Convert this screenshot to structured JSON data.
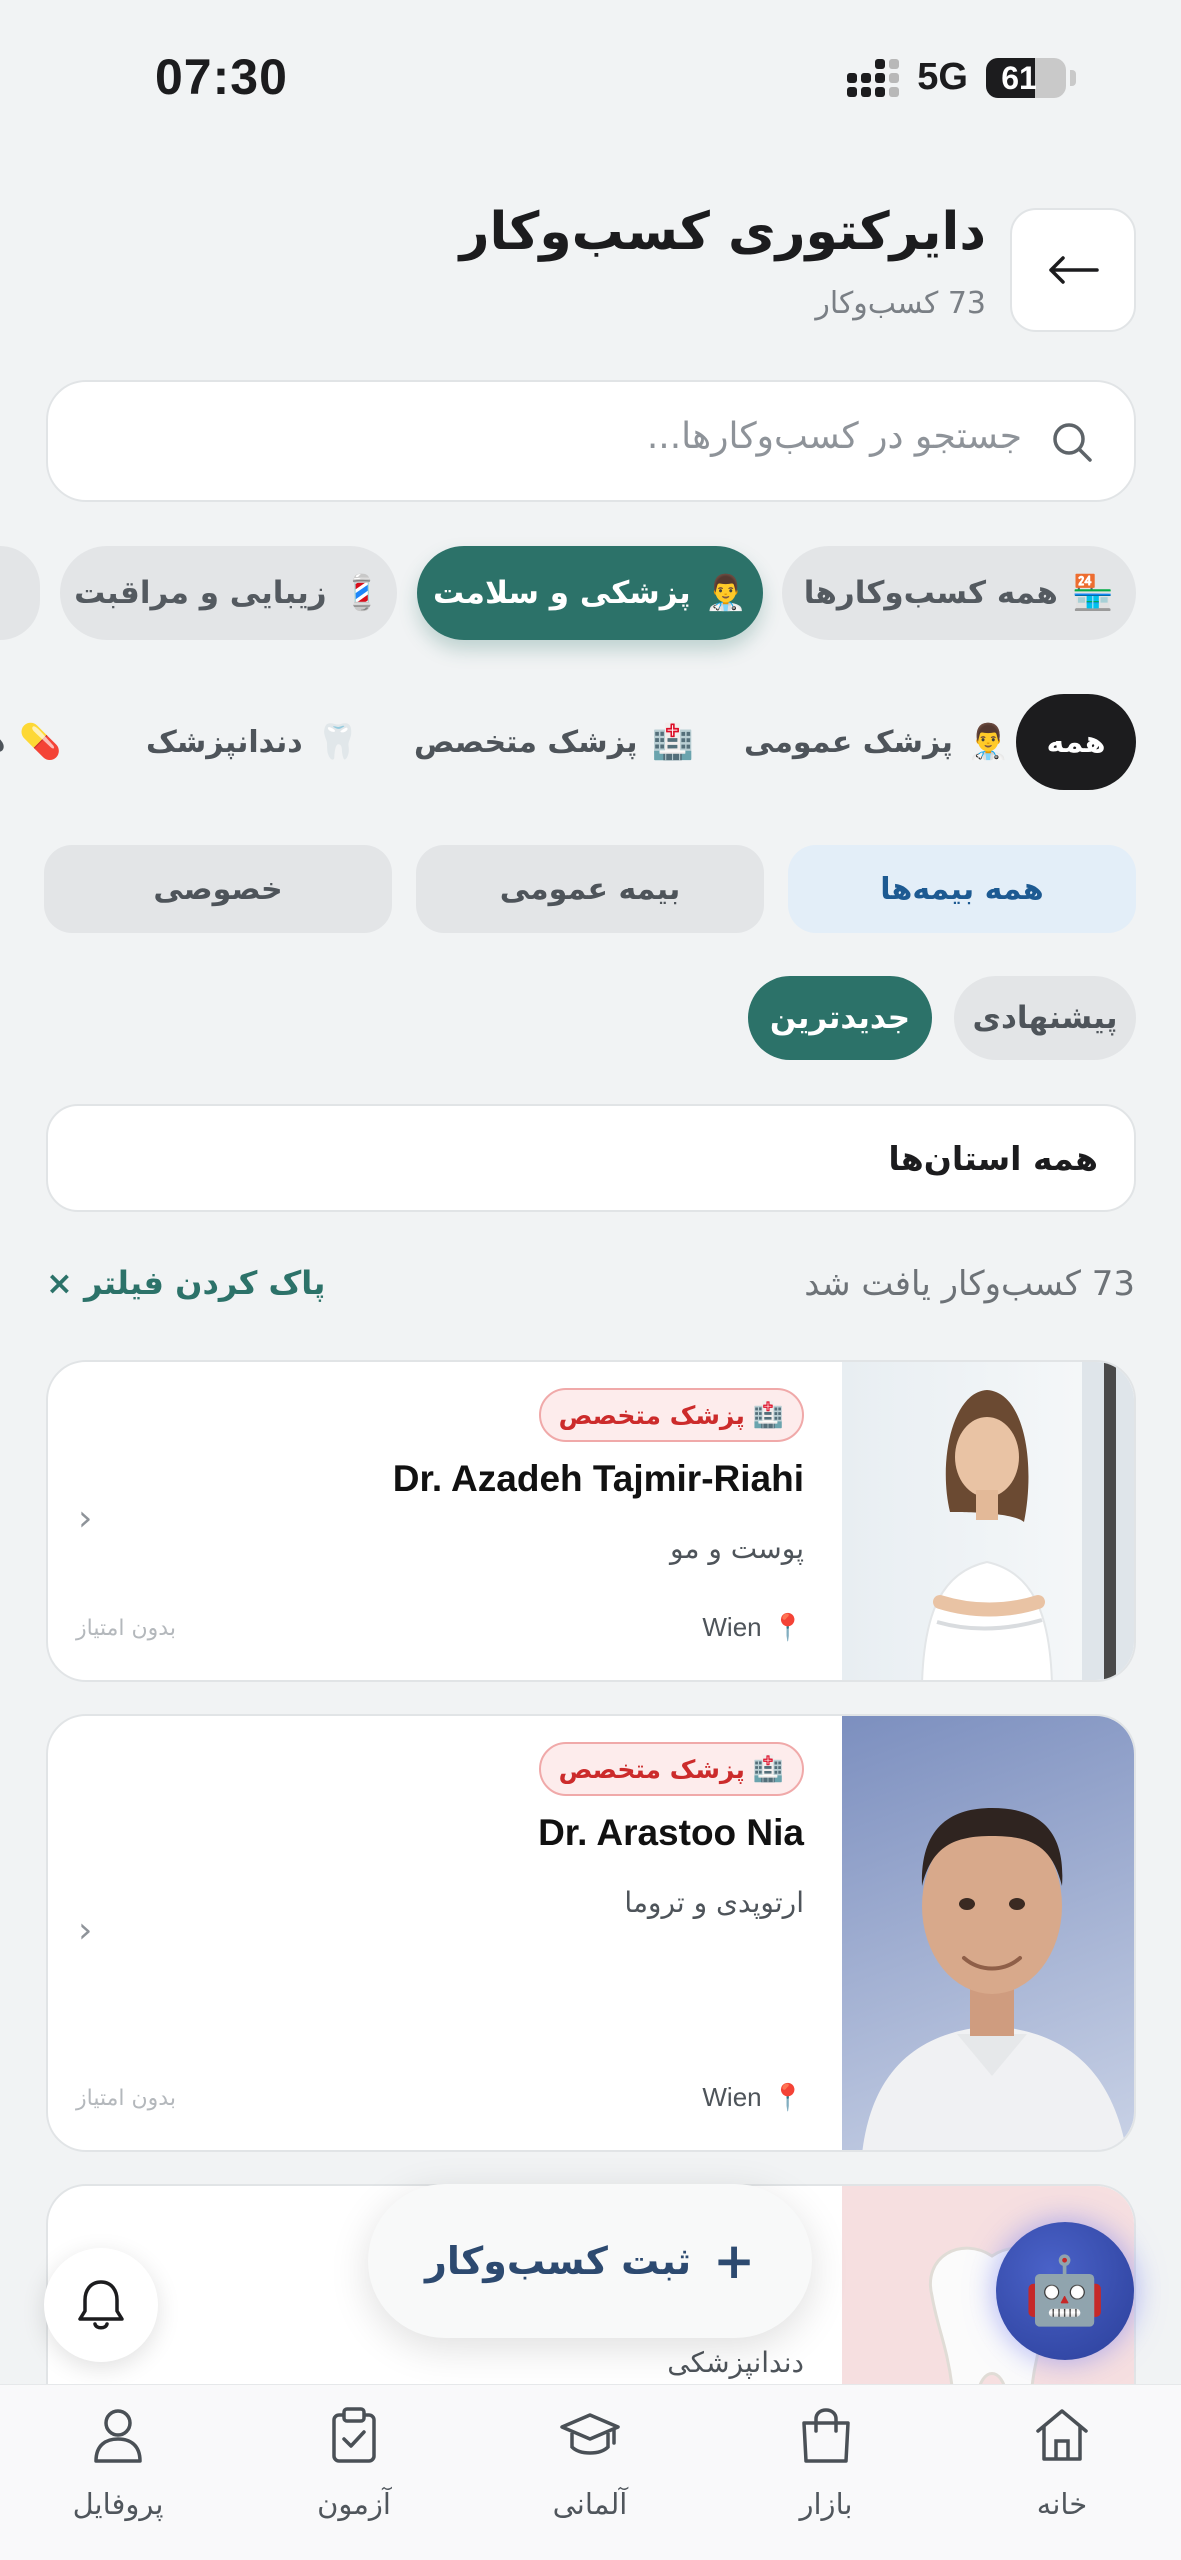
{
  "status_bar": {
    "time": "07:30",
    "network": "5G",
    "battery": "61"
  },
  "header": {
    "title": "دایرکتوری کسب‌وکار",
    "subtitle": "73 کسب‌وکار",
    "back_icon": "arrow-left-icon"
  },
  "search": {
    "placeholder": "جستجو در کسب‌وکارها...",
    "value": ""
  },
  "categories": [
    {
      "emoji": "🏪",
      "label": "همه کسب‌وکارها",
      "active": false
    },
    {
      "emoji": "👨‍⚕️",
      "label": "پزشکی و سلامت",
      "active": true
    },
    {
      "emoji": "💈",
      "label": "زیبایی و مراقبت",
      "active": false
    }
  ],
  "subcategories": [
    {
      "emoji": "",
      "label": "همه",
      "active": true
    },
    {
      "emoji": "👨‍⚕️",
      "label": "پزشک عمومی"
    },
    {
      "emoji": "🏥",
      "label": "پزشک متخصص"
    },
    {
      "emoji": "🦷",
      "label": "دندانپزشک"
    },
    {
      "emoji": "💊",
      "label": "د"
    }
  ],
  "insurance": [
    {
      "label": "همه بیمه‌ها",
      "active": true
    },
    {
      "label": "بیمه عمومی",
      "active": false
    },
    {
      "label": "خصوصی",
      "active": false
    }
  ],
  "sort": [
    {
      "label": "پیشنهادی",
      "active": false
    },
    {
      "label": "جدیدترین",
      "active": true
    }
  ],
  "province": {
    "value": "همه استان‌ها"
  },
  "results": {
    "count_text": "73 کسب‌وکار یافت شد",
    "clear_filter": "پاک کردن فیلتر ×"
  },
  "businesses": [
    {
      "badge": "پزشک متخصص",
      "name": "Dr. Azadeh Tajmir-Riahi",
      "specialty": "پوست و مو",
      "city": "Wien",
      "rating": "بدون امتیاز"
    },
    {
      "badge": "پزشک متخصص",
      "name": "Dr. Arastoo Nia",
      "specialty": "ارتوپدی و تروما",
      "city": "Wien",
      "rating": "بدون امتیاز"
    },
    {
      "name": "",
      "specialty": "دندانپزشکی"
    }
  ],
  "fab": {
    "label": "ثبت کسب‌وکار",
    "icon": "plus-icon"
  },
  "bottom_nav": [
    {
      "label": "خانه",
      "icon": "home-icon"
    },
    {
      "label": "بازار",
      "icon": "shopping-bag-icon"
    },
    {
      "label": "آلمانی",
      "icon": "graduation-cap-icon"
    },
    {
      "label": "آزمون",
      "icon": "clipboard-check-icon"
    },
    {
      "label": "پروفایل",
      "icon": "user-icon"
    }
  ],
  "colors": {
    "accent": "#2c7269",
    "badge_red": "#cc2b2b",
    "insurance_blue": "#1d5a92",
    "fab_text": "#2d4a70"
  }
}
